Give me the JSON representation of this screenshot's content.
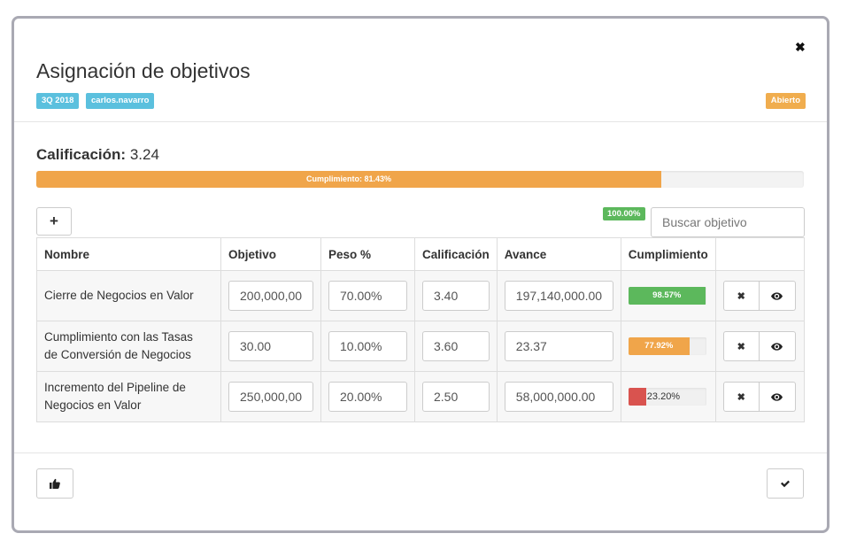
{
  "modal": {
    "title": "Asignación de objetivos",
    "labels": {
      "period": "3Q 2018",
      "user": "carlos.navarro",
      "status": "Abierto"
    },
    "calificacion_label": "Calificación:",
    "calificacion_value": "3.24",
    "progress": {
      "label": "Cumplimiento: 81.43%",
      "percent": 81.43,
      "color": "#f0a54a"
    },
    "badge_total": "100.00%",
    "search_placeholder": "Buscar objetivo"
  },
  "table": {
    "headers": [
      "Nombre",
      "Objetivo",
      "Peso %",
      "Calificación",
      "Avance",
      "Cumplimiento",
      ""
    ],
    "rows": [
      {
        "name_lines": [
          "Cierre de Negocios en Valor",
          ""
        ],
        "objetivo": "200,000,00",
        "peso": "70.00%",
        "calificacion": "3.40",
        "avance": "197,140,000.00",
        "cumplimiento": "98.57%",
        "cumplimiento_pct": 98.57,
        "bar_color": "#5cb85c"
      },
      {
        "name_lines": [
          "Cumplimiento con las Tasas",
          "de Conversión de Negocios"
        ],
        "objetivo": "30.00",
        "peso": "10.00%",
        "calificacion": "3.60",
        "avance": "23.37",
        "cumplimiento": "77.92%",
        "cumplimiento_pct": 77.92,
        "bar_color": "#f0a54a"
      },
      {
        "name_lines": [
          "Incremento del Pipeline de",
          "Negocios en Valor"
        ],
        "objetivo": "250,000,00",
        "peso": "20.00%",
        "calificacion": "2.50",
        "avance": "58,000,000.00",
        "cumplimiento": "23.20%",
        "cumplimiento_pct": 23.2,
        "bar_color": "#d9534f"
      }
    ]
  },
  "colors": {
    "info": "#5bc0de",
    "warning": "#f0ad4e",
    "success": "#5cb85c",
    "danger": "#d9534f"
  },
  "icons": {
    "close": "close-icon",
    "add": "plus-icon",
    "remove": "x-icon",
    "view": "eye-icon",
    "like": "thumbs-up-icon",
    "confirm": "check-icon"
  }
}
